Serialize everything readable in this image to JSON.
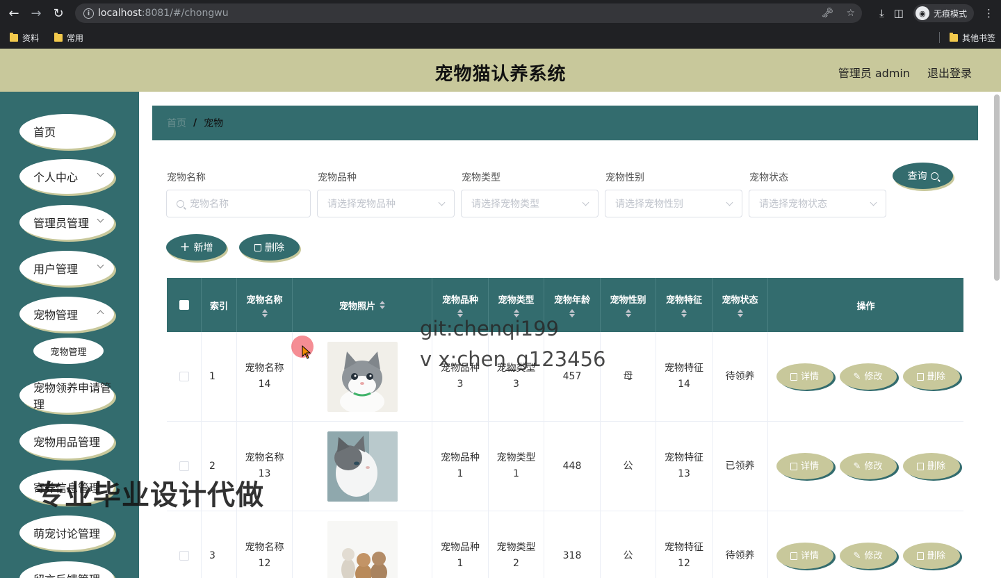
{
  "browser": {
    "url_host": "localhost",
    "url_rest": ":8081/#/chongwu",
    "incognito_label": "无痕模式",
    "bookmarks": [
      "资料",
      "常用"
    ],
    "other_bookmarks": "其他书签"
  },
  "header": {
    "title": "宠物猫认养系统",
    "user": "管理员 admin",
    "logout": "退出登录"
  },
  "sidebar": {
    "items": [
      {
        "label": "首页"
      },
      {
        "label": "个人中心"
      },
      {
        "label": "管理员管理"
      },
      {
        "label": "用户管理"
      },
      {
        "label": "宠物管理"
      },
      {
        "label": "宠物管理"
      },
      {
        "label": "宠物领养申请管理"
      },
      {
        "label": "宠物用品管理"
      },
      {
        "label": "寄养信息管理"
      },
      {
        "label": "萌宠讨论管理"
      },
      {
        "label": "留言反馈管理"
      }
    ]
  },
  "breadcrumb": {
    "home": "首页",
    "current": "宠物"
  },
  "filters": [
    {
      "label": "宠物名称",
      "placeholder": "宠物名称"
    },
    {
      "label": "宠物品种",
      "placeholder": "请选择宠物品种"
    },
    {
      "label": "宠物类型",
      "placeholder": "请选择宠物类型"
    },
    {
      "label": "宠物性别",
      "placeholder": "请选择宠物性别"
    },
    {
      "label": "宠物状态",
      "placeholder": "请选择宠物状态"
    }
  ],
  "actions": {
    "search": "查询",
    "add": "新增",
    "delete": "删除"
  },
  "table": {
    "columns": [
      "索引",
      "宠物名称",
      "宠物照片",
      "宠物品种",
      "宠物类型",
      "宠物年龄",
      "宠物性别",
      "宠物特征",
      "宠物状态",
      "操作"
    ],
    "rows": [
      {
        "index": "1",
        "name": "宠物名称14",
        "breed": "宠物品种3",
        "type": "宠物类型3",
        "age": "457",
        "gender": "母",
        "feature": "宠物特征14",
        "status": "待领养"
      },
      {
        "index": "2",
        "name": "宠物名称13",
        "breed": "宠物品种1",
        "type": "宠物类型1",
        "age": "448",
        "gender": "公",
        "feature": "宠物特征13",
        "status": "已领养"
      },
      {
        "index": "3",
        "name": "宠物名称12",
        "breed": "宠物品种1",
        "type": "宠物类型2",
        "age": "318",
        "gender": "公",
        "feature": "宠物特征12",
        "status": "待领养"
      }
    ],
    "row_actions": {
      "detail": "详情",
      "edit": "修改",
      "delete": "删除"
    }
  },
  "overlays": {
    "watermark_1": "git:chenqi199",
    "watermark_2": "v x:chen_g123456",
    "watermark_3": "专业毕业设计代做"
  }
}
